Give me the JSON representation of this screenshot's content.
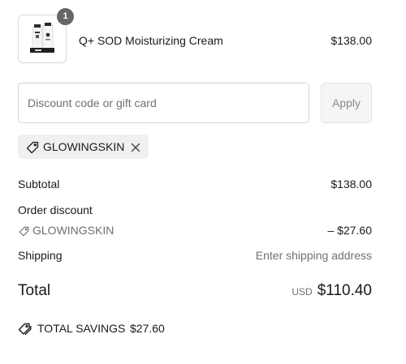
{
  "product": {
    "name": "Q+ SOD Moisturizing Cream",
    "price": "$138.00",
    "quantity": "1",
    "thumbnail_icon": "product-bottles-image"
  },
  "discount": {
    "placeholder": "Discount code or gift card",
    "value": "",
    "apply_label": "Apply"
  },
  "applied_code": {
    "code": "GLOWINGSKIN",
    "tag_icon": "tag-icon",
    "remove_icon": "close-icon"
  },
  "summary": {
    "subtotal_label": "Subtotal",
    "subtotal_value": "$138.00",
    "order_discount_label": "Order discount",
    "discount_code": "GLOWINGSKIN",
    "discount_value": "– $27.60",
    "shipping_label": "Shipping",
    "shipping_value": "Enter shipping address",
    "total_label": "Total",
    "currency": "USD",
    "total_value": "$110.40",
    "savings_label": "TOTAL SAVINGS",
    "savings_value": "$27.60",
    "savings_icon": "tags-icon"
  },
  "colors": {
    "text": "#1a1a1a",
    "muted": "#707070",
    "badge": "#666666",
    "tag_bg": "#f0f0f0"
  }
}
